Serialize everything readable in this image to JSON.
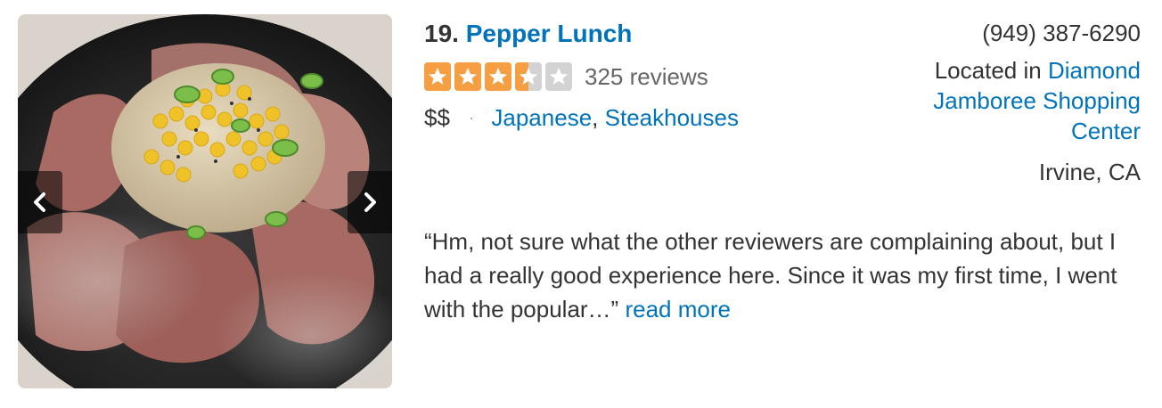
{
  "business": {
    "rank": "19.",
    "name": "Pepper Lunch",
    "rating": 3.5,
    "review_count": "325 reviews",
    "price": "$$",
    "separator": "·",
    "categories": [
      "Japanese",
      "Steakhouses"
    ],
    "category_comma": ",",
    "phone": "(949) 387-6290",
    "located_prefix": "Located in",
    "location_name": "Diamond Jamboree Shopping Center",
    "city": "Irvine, CA"
  },
  "snippet": {
    "text": "“Hm, not sure what the other reviewers are complaining about, but I had a really good experience here. Since it was my first time, I went with the popular…”",
    "read_more": "read more"
  },
  "photo": {
    "alt": "Pepper Lunch dish photo",
    "prev_icon": "chevron-left-icon",
    "next_icon": "chevron-right-icon"
  },
  "colors": {
    "link": "#0073bb",
    "star_filled": "#f59e42",
    "star_empty": "#d3d3d3",
    "text": "#333333",
    "muted": "#666666"
  }
}
